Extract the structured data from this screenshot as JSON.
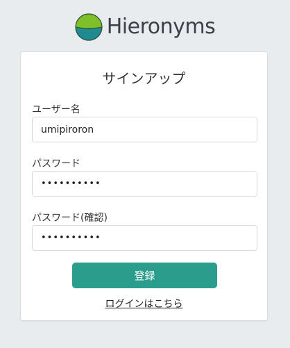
{
  "app": {
    "name": "Hieronyms",
    "logo_icon": "hieronyms-globe-logo",
    "colors": {
      "accent": "#2a9d8c",
      "logo_top": "#7fbf2a",
      "logo_bottom": "#1f8a92",
      "background": "#e9ecef"
    }
  },
  "signup": {
    "title": "サインアップ",
    "username": {
      "label": "ユーザー名",
      "value": "umipiroron"
    },
    "password": {
      "label": "パスワード",
      "masked_value": "••••••••••"
    },
    "password_confirm": {
      "label": "パスワード(確認)",
      "masked_value": "••••••••••"
    },
    "submit_label": "登録",
    "login_link_label": "ログインはこちら"
  }
}
